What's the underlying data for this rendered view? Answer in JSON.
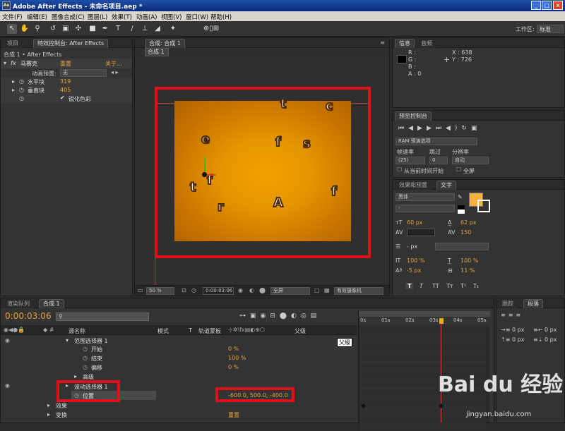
{
  "window": {
    "title": "Adobe After Effects - 未命名项目.aep *",
    "controls": [
      "_",
      "□",
      "×"
    ]
  },
  "menu": [
    "文件(F)",
    "编辑(E)",
    "图像合成(C)",
    "图层(L)",
    "效果(T)",
    "动画(A)",
    "视图(V)",
    "窗口(W)",
    "帮助(H)"
  ],
  "toolbar": {
    "workspace_label": "工作区:",
    "workspace_value": "标准"
  },
  "project_panel": {
    "tabs": [
      "项目",
      "特效控制台: After Effects"
    ],
    "breadcrumb": "合成 1 • After Effects",
    "effect": {
      "name": "马赛克",
      "reset": "重置",
      "about": "关于..."
    },
    "preset_label": "动画预置:",
    "preset_value": "无",
    "params": [
      {
        "label": "水平块",
        "value": "319"
      },
      {
        "label": "垂直块",
        "value": "405"
      }
    ],
    "checkbox_label": "锐化色彩"
  },
  "comp_panel": {
    "tab": "合成: 合成 1",
    "subtab": "合成 1",
    "letters": [
      "t",
      "c",
      "e",
      "f",
      "s",
      "t",
      "f",
      "A",
      "f",
      "r"
    ],
    "bottom": {
      "zoom": "50 %",
      "timecode": "0:00:03:06",
      "resolution": "全屏",
      "camera": "有效摄像机"
    }
  },
  "info_panel": {
    "tabs": [
      "信息",
      "音频"
    ],
    "rgba": [
      "R :",
      "G :",
      "B :",
      "A : 0"
    ],
    "coords": [
      "X : 638",
      "Y : 726"
    ]
  },
  "preview_panel": {
    "tab": "预览控制台",
    "ram": "RAM 预演选项",
    "labels": [
      "帧速率",
      "跳过",
      "分辨率"
    ],
    "values": [
      "(25)",
      "0",
      "自动"
    ],
    "checks": [
      "从当前时间开始",
      "全屏"
    ]
  },
  "char_panel": {
    "tabs": [
      "效果和预置",
      "文字"
    ],
    "font": "黑体",
    "style": "-",
    "size": "60 px",
    "leading": "62 px",
    "tracking": "150",
    "stroke": "- px",
    "vscale": "100 %",
    "hscale": "100 %",
    "baseline": "-5 px",
    "tsume": "11 %",
    "fill_color": "#f7b13c",
    "styles": [
      "T",
      "T",
      "TT",
      "Tт",
      "T¹",
      "T₁"
    ]
  },
  "timeline": {
    "tabs": [
      "渲染队列",
      "合成 1"
    ],
    "timecode": "0:00:03:06",
    "headers": [
      "源名称",
      "模式",
      "T",
      "轨道蒙板",
      "父级"
    ],
    "rows": [
      {
        "label": "范围选择器 1",
        "value": ""
      },
      {
        "label": "开始",
        "value": "0 %"
      },
      {
        "label": "结束",
        "value": "100 %"
      },
      {
        "label": "偏移",
        "value": "0 %"
      },
      {
        "label": "高级",
        "value": ""
      },
      {
        "label": "波动选择器 1",
        "value": ""
      },
      {
        "label": "位置",
        "value": "-600.0, 500.0, -400.0"
      },
      {
        "label": "效果",
        "value": ""
      },
      {
        "label": "变换",
        "value": "重置"
      }
    ],
    "tooltip": "父级",
    "ruler": [
      "0s",
      "01s",
      "02s",
      "03s",
      "04s",
      "05s"
    ]
  },
  "para_panel": {
    "tabs": [
      "跟踪",
      "段落"
    ],
    "values": [
      "0 px",
      "0 px",
      "0 px",
      "0 px"
    ]
  },
  "watermark": {
    "brand": "Bai du 经验",
    "url": "jingyan.baidu.com"
  }
}
